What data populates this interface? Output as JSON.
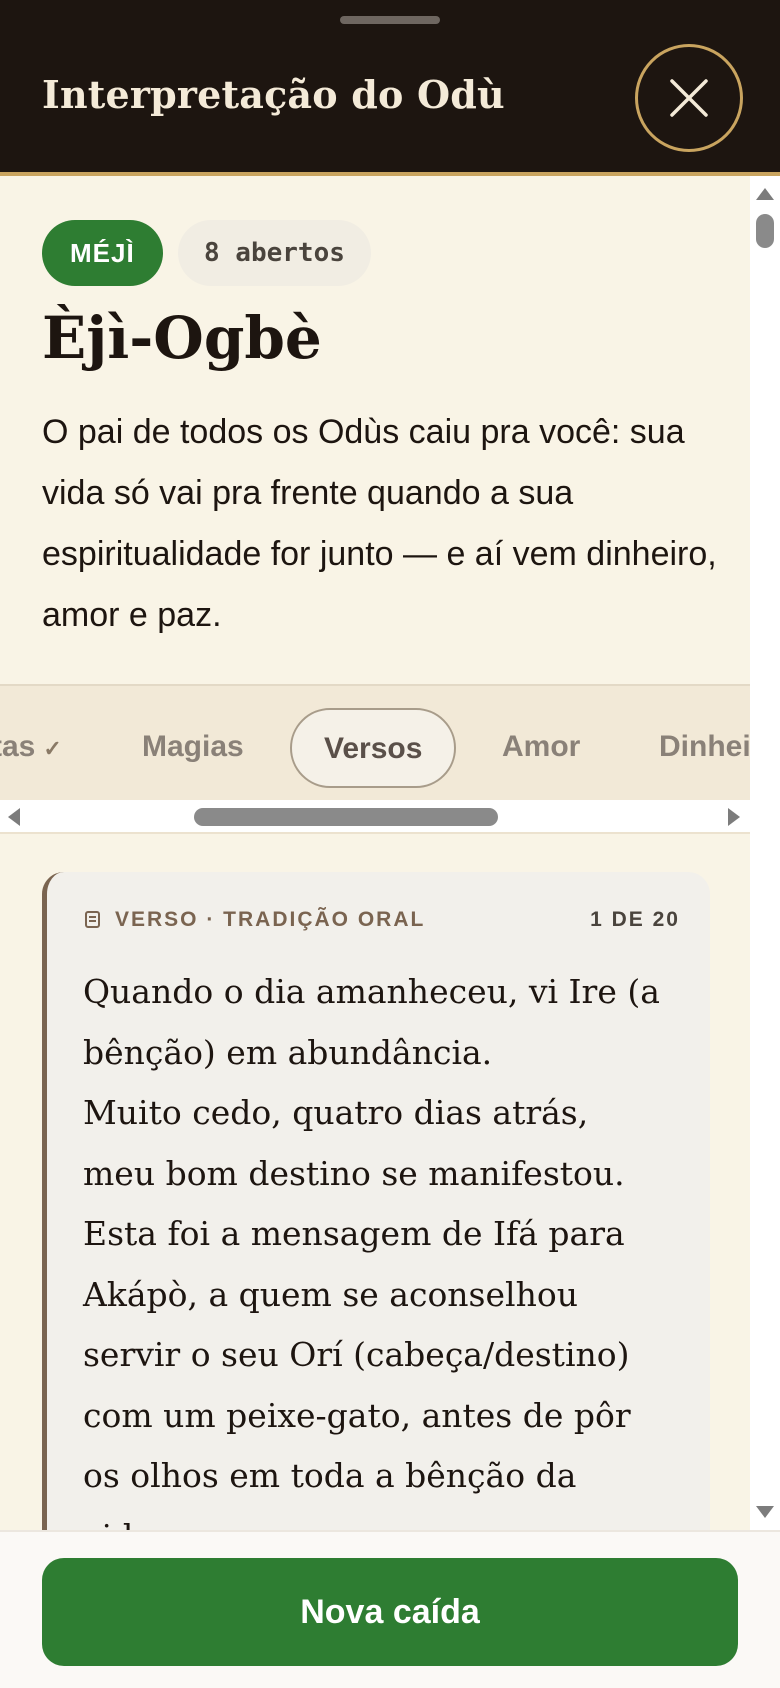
{
  "header": {
    "title": "Interpretação do Odù",
    "close_icon": "close-icon"
  },
  "odu": {
    "badge": "MÉJÌ",
    "opened": "8 abertos",
    "name": "Èjì-Ogbè",
    "summary": "O pai de todos os Odùs caiu pra você: sua vida só vai pra frente quando a sua espiritualidade for junto — e aí vem dinheiro, amor e paz."
  },
  "tabs": [
    {
      "label": "tas",
      "checked": true,
      "partial": true
    },
    {
      "label": "Magias",
      "checked": false
    },
    {
      "label": "Versos",
      "checked": false,
      "active": true
    },
    {
      "label": "Amor",
      "checked": false
    },
    {
      "label": "Dinhei",
      "checked": false,
      "partial": true
    }
  ],
  "verse_card": {
    "icon": "scroll-icon",
    "label": "VERSO · TRADIÇÃO ORAL",
    "counter": "1 DE 20",
    "lines": [
      "Quando o dia amanheceu, vi Ire (a",
      "bênção) em abundância.",
      "Muito cedo, quatro dias atrás,",
      "meu bom destino se manifestou.",
      "Esta foi a mensagem de Ifá para",
      "Akápò, a quem se aconselhou",
      "servir o seu Orí (cabeça/destino)",
      "com um peixe-gato, antes de pôr",
      "os olhos em toda a bênção da",
      "vida."
    ]
  },
  "footer": {
    "primary_button": "Nova caída"
  },
  "colors": {
    "header_bg": "#1d1510",
    "accent_gold": "#c9a45f",
    "panel_bg": "#f9f4e6",
    "green": "#2e7d32"
  }
}
